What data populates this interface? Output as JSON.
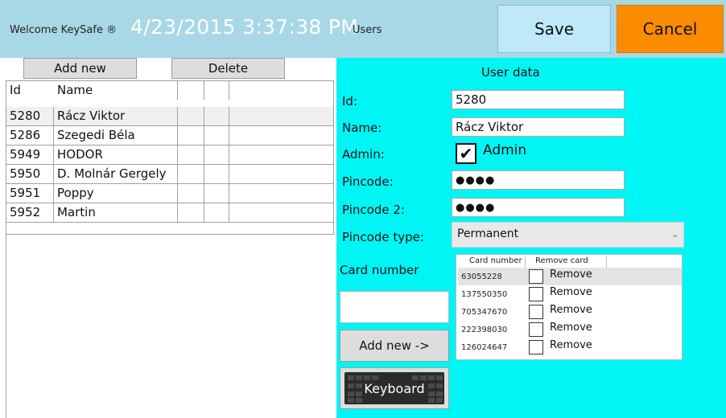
{
  "header": {
    "welcome": "Welcome KeySafe ®",
    "datetime": "4/23/2015 3:37:38 PM",
    "section": "Users",
    "save_label": "Save",
    "cancel_label": "Cancel",
    "colors": {
      "header_bg": "#a8d8e6",
      "save_bg": "#bfe8f9",
      "cancel_bg": "#fb8c00",
      "panel_bg": "#00f5f5"
    }
  },
  "list_toolbar": {
    "add_new_label": "Add new",
    "delete_label": "Delete"
  },
  "user_table": {
    "columns": [
      "Id",
      "Name"
    ],
    "rows": [
      {
        "id": "5280",
        "name": "Rácz Viktor",
        "selected": true
      },
      {
        "id": "5286",
        "name": "Szegedi Béla"
      },
      {
        "id": "5949",
        "name": "HODOR"
      },
      {
        "id": "5950",
        "name": "D. Molnár Gergely"
      },
      {
        "id": "5951",
        "name": "Poppy"
      },
      {
        "id": "5952",
        "name": "Martin"
      }
    ]
  },
  "user_data": {
    "title": "User data",
    "id_label": "Id:",
    "id_value": "5280",
    "name_label": "Name:",
    "name_value": "Rácz Viktor",
    "admin_label": "Admin:",
    "admin_checked": true,
    "admin_checkbox_label": "Admin",
    "pincode_label": "Pincode:",
    "pincode_value": "●●●●",
    "pincode2_label": "Pincode 2:",
    "pincode2_value": "●●●●",
    "pincode_type_label": "Pincode type:",
    "pincode_type_value": "Permanent",
    "card_number_label": "Card number",
    "card_number_value": "",
    "add_card_label": "Add new ->",
    "keyboard_label": "Keyboard"
  },
  "card_table": {
    "columns": [
      "Card number",
      "Remove card"
    ],
    "rows": [
      {
        "number": "63055228",
        "remove_label": "Remove",
        "checked": false,
        "selected": true
      },
      {
        "number": "137550350",
        "remove_label": "Remove",
        "checked": false
      },
      {
        "number": "705347670",
        "remove_label": "Remove",
        "checked": false
      },
      {
        "number": "222398030",
        "remove_label": "Remove",
        "checked": false
      },
      {
        "number": "126024647",
        "remove_label": "Remove",
        "checked": false
      }
    ]
  }
}
